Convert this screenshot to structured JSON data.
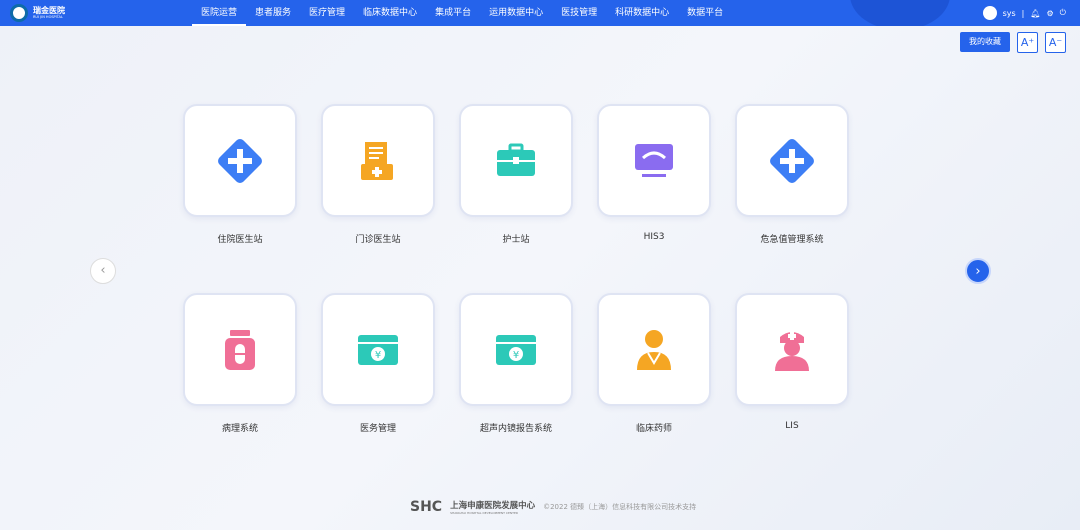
{
  "header": {
    "logo_cn": "瑞金医院",
    "logo_en": "RUI JIN HOSPITAL",
    "nav": [
      "医院运营",
      "患者服务",
      "医疗管理",
      "临床数据中心",
      "集成平台",
      "运用数据中心",
      "医技管理",
      "科研数据中心",
      "数据平台"
    ],
    "active_nav": "医院运营",
    "username": "sys"
  },
  "toolbar": {
    "favorites": "我的收藏",
    "font_increase": "A⁺",
    "font_decrease": "A⁻"
  },
  "apps": [
    {
      "label": "住院医生站",
      "icon": "medical-cross-icon",
      "color": "#3d7ef5"
    },
    {
      "label": "门诊医生站",
      "icon": "clipboard-icon",
      "color": "#f5a623"
    },
    {
      "label": "护士站",
      "icon": "first-aid-kit-icon",
      "color": "#2cc9b8"
    },
    {
      "label": "HIS3",
      "icon": "monitor-icon",
      "color": "#8a6cf0"
    },
    {
      "label": "危急值管理系统",
      "icon": "medical-cross-icon",
      "color": "#3d7ef5"
    },
    {
      "label": "病理系统",
      "icon": "medicine-bottle-icon",
      "color": "#f06f96"
    },
    {
      "label": "医务管理",
      "icon": "money-box-icon",
      "color": "#2cc9b8"
    },
    {
      "label": "超声内镜报告系统",
      "icon": "money-box-icon",
      "color": "#2cc9b8"
    },
    {
      "label": "临床药师",
      "icon": "doctor-icon",
      "color": "#f5a623"
    },
    {
      "label": "LIS",
      "icon": "nurse-icon",
      "color": "#f06f96"
    }
  ],
  "footer": {
    "org_cn": "上海申康医院发展中心",
    "org_en": "SHANGHAI HOSPITAL DEVELOPMENT CENTER",
    "copyright": "©2022 德臻（上海）信息科技有限公司技术支持"
  }
}
